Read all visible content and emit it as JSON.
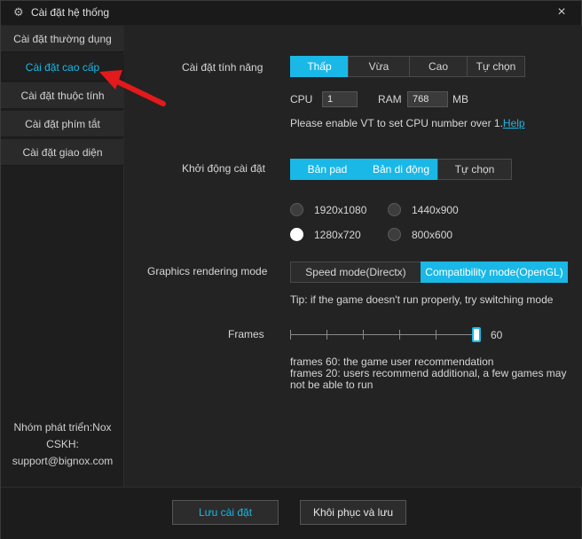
{
  "window": {
    "title": "Cài đặt hệ thống",
    "close": "×"
  },
  "sidebar": {
    "items": [
      {
        "label": "Cài đặt thường dụng",
        "active": false
      },
      {
        "label": "Cài đặt cao cấp",
        "active": true
      },
      {
        "label": "Cài đặt thuộc tính",
        "active": false
      },
      {
        "label": "Cài đặt phím tắt",
        "active": false
      },
      {
        "label": "Cài đặt giao diện",
        "active": false
      }
    ],
    "footer": {
      "developer": "Nhóm phát triển:Nox",
      "support_label": "CSKH:",
      "support_email": "support@bignox.com"
    }
  },
  "performance": {
    "label": "Cài đặt tính năng",
    "options": [
      "Thấp",
      "Vừa",
      "Cao",
      "Tự chọn"
    ],
    "selected": "Thấp",
    "cpu_label": "CPU",
    "cpu_value": "1",
    "ram_label": "RAM",
    "ram_value": "768",
    "ram_unit": "MB",
    "note": "Please enable VT to set CPU number over 1.",
    "help_link": "Help"
  },
  "startup": {
    "label": "Khởi động cài đặt",
    "options": [
      "Bản pad",
      "Bản di động",
      "Tự chọn"
    ],
    "selected": [
      "Bản pad",
      "Bản di động"
    ],
    "resolutions": [
      {
        "label": "1920x1080",
        "selected": false
      },
      {
        "label": "1440x900",
        "selected": false
      },
      {
        "label": "1280x720",
        "selected": true
      },
      {
        "label": "800x600",
        "selected": false
      }
    ]
  },
  "graphics": {
    "label": "Graphics rendering mode",
    "options": [
      "Speed mode(Directx)",
      "Compatibility mode(OpenGL)"
    ],
    "selected": "Compatibility mode(OpenGL)",
    "tip": "Tip: if the game doesn't run properly, try switching mode"
  },
  "frames": {
    "label": "Frames",
    "value": 60,
    "value_text": "60",
    "min": 10,
    "max": 60,
    "note_line1": "frames 60: the game user recommendation",
    "note_line2": "frames 20: users recommend additional, a few games may",
    "note_line3": "not be able to run"
  },
  "footer": {
    "save": "Lưu cài đặt",
    "restore": "Khôi phục và lưu"
  },
  "colors": {
    "accent": "#19b8e6",
    "annotation_arrow": "#e3191b"
  },
  "icons": {
    "title": "gear-icon",
    "close": "close-icon",
    "annotation": "red-arrow-icon"
  }
}
